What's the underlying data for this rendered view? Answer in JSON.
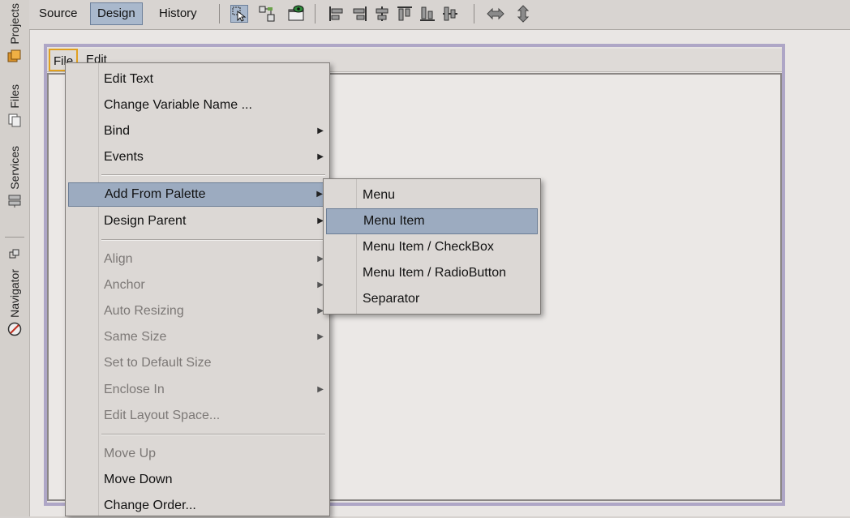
{
  "sidebar": {
    "tabs": [
      {
        "label": "Projects",
        "icon": "projects-icon"
      },
      {
        "label": "Files",
        "icon": "files-icon"
      },
      {
        "label": "Services",
        "icon": "services-icon"
      },
      {
        "label": "Navigator",
        "icon": "navigator-icon"
      }
    ]
  },
  "toolbar": {
    "source_label": "Source",
    "design_label": "Design",
    "history_label": "History",
    "active_tab": "Design",
    "icons": [
      "selection-mode-icon",
      "connection-mode-icon",
      "preview-design-icon",
      "align-left-icon",
      "align-right-icon",
      "center-horizontally-icon",
      "align-top-icon",
      "align-bottom-icon",
      "center-vertically-icon",
      "resize-horizontally-icon",
      "resize-vertically-icon"
    ]
  },
  "designer": {
    "menubar": {
      "file_label": "File",
      "edit_label": "Edit"
    }
  },
  "context_menu": {
    "items": [
      {
        "label": "Edit Text",
        "enabled": true,
        "submenu": false
      },
      {
        "label": "Change Variable Name ...",
        "enabled": true,
        "submenu": false
      },
      {
        "label": "Bind",
        "enabled": true,
        "submenu": true
      },
      {
        "label": "Events",
        "enabled": true,
        "submenu": true
      },
      {
        "label": "Add From Palette",
        "enabled": true,
        "submenu": true,
        "highlighted": true
      },
      {
        "label": "Design Parent",
        "enabled": true,
        "submenu": true
      },
      {
        "label": "Align",
        "enabled": false,
        "submenu": true
      },
      {
        "label": "Anchor",
        "enabled": false,
        "submenu": true
      },
      {
        "label": "Auto Resizing",
        "enabled": false,
        "submenu": true
      },
      {
        "label": "Same Size",
        "enabled": false,
        "submenu": true
      },
      {
        "label": "Set to Default Size",
        "enabled": false,
        "submenu": false
      },
      {
        "label": "Enclose In",
        "enabled": false,
        "submenu": true
      },
      {
        "label": "Edit Layout Space...",
        "enabled": false,
        "submenu": false
      },
      {
        "label": "Move Up",
        "enabled": false,
        "submenu": false
      },
      {
        "label": "Move Down",
        "enabled": true,
        "submenu": false
      },
      {
        "label": "Change Order...",
        "enabled": true,
        "submenu": false
      }
    ]
  },
  "submenu": {
    "items": [
      {
        "label": "Menu"
      },
      {
        "label": "Menu Item",
        "highlighted": true
      },
      {
        "label": "Menu Item / CheckBox"
      },
      {
        "label": "Menu Item / RadioButton"
      },
      {
        "label": "Separator"
      }
    ]
  },
  "colors": {
    "highlight": "#9cabc0",
    "active_tab": "#a9b8cc",
    "frame_border": "#aea6c6",
    "file_focus": "#e0a020"
  }
}
